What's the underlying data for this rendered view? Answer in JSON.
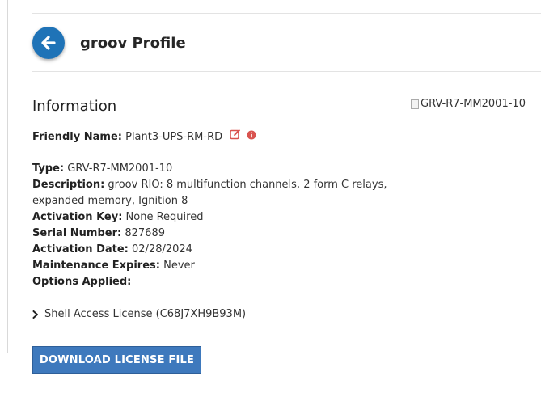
{
  "header": {
    "title": "groov Profile"
  },
  "info": {
    "section_title": "Information",
    "device_image_alt": "GRV-R7-MM2001-10",
    "friendly_name": {
      "label": "Friendly Name:",
      "value": "Plant3-UPS-RM-RD"
    },
    "type": {
      "label": "Type:",
      "value": "GRV-R7-MM2001-10"
    },
    "description": {
      "label": "Description:",
      "value_line1": "groov RIO: 8 multifunction channels, 2 form C relays,",
      "value_line2": "expanded memory, Ignition 8"
    },
    "activation_key": {
      "label": "Activation Key:",
      "value": "None Required"
    },
    "serial_number": {
      "label": "Serial Number:",
      "value": "827689"
    },
    "activation_date": {
      "label": "Activation Date:",
      "value": "02/28/2024"
    },
    "maintenance_expires": {
      "label": "Maintenance Expires:",
      "value": "Never"
    },
    "options_applied": {
      "label": "Options Applied:"
    }
  },
  "license": {
    "label": "Shell Access License (C68J7XH9B93M)"
  },
  "download_button": {
    "label": "DOWNLOAD LICENSE FILE"
  },
  "colors": {
    "accent": "#1f73b7",
    "button": "#3e79bd",
    "alert_red": "#d9534f"
  },
  "icons": {
    "back": "arrow-left-icon",
    "edit": "edit-icon",
    "info": "info-icon",
    "expand": "chevron-right-icon"
  }
}
